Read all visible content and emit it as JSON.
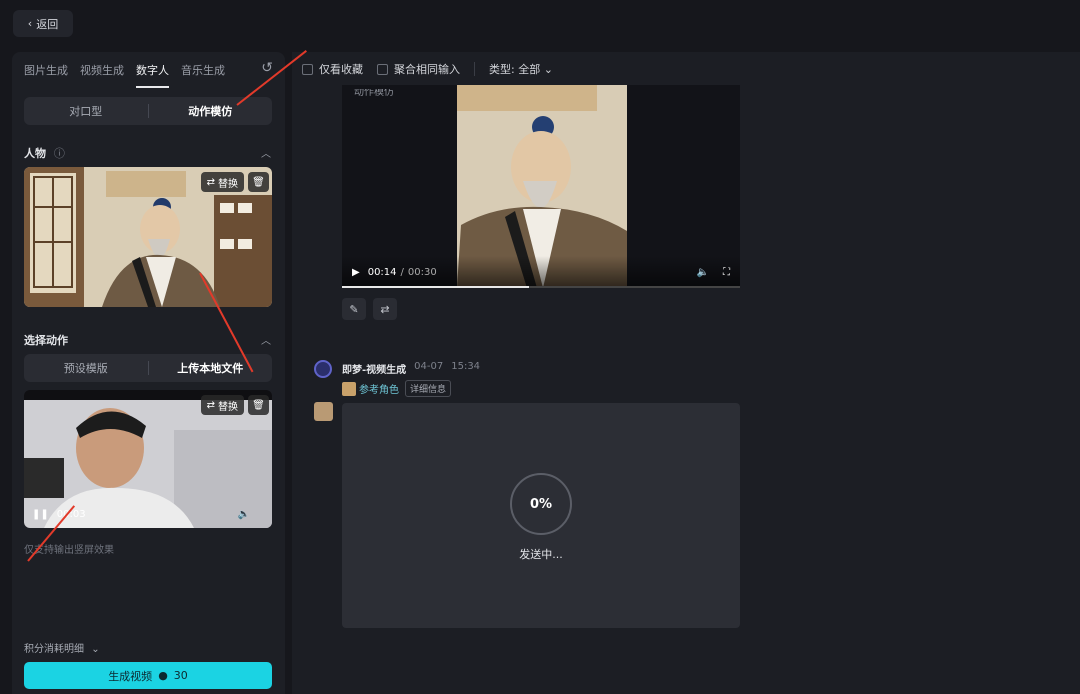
{
  "top": {
    "back_label": "返回"
  },
  "left": {
    "tabs": [
      {
        "label": "图片生成",
        "active": false
      },
      {
        "label": "视频生成",
        "active": false
      },
      {
        "label": "数字人",
        "active": true
      },
      {
        "label": "音乐生成",
        "active": false
      }
    ],
    "mode": {
      "options": [
        "对口型",
        "动作模仿"
      ],
      "selected": "动作模仿"
    },
    "person_section": {
      "title": "人物",
      "replace_label": "替换"
    },
    "action_section": {
      "title": "选择动作",
      "options": [
        "预设模版",
        "上传本地文件"
      ],
      "replace_label": "替换",
      "time": "00:03"
    },
    "note": "仅支持输出竖屏效果",
    "credits_label": "积分消耗明细",
    "generate": {
      "label": "生成视频",
      "cost": "30"
    }
  },
  "main": {
    "filters": {
      "favorites": "仅看收藏",
      "merge": "聚合相同输入",
      "type_label": "类型: 全部"
    },
    "player": {
      "current": "00:14",
      "duration": "00:30",
      "overlay": "动作模仿",
      "progress": 0.47
    },
    "message": {
      "sender": "即梦-视频生成",
      "date": "04-07",
      "time": "15:34",
      "ref_tag": "参考角色",
      "detail_label": "详细信息",
      "progress": "0%",
      "status": "发送中..."
    }
  },
  "colors": {
    "accent": "#1bd3e3",
    "arrow": "#e23a2a"
  }
}
